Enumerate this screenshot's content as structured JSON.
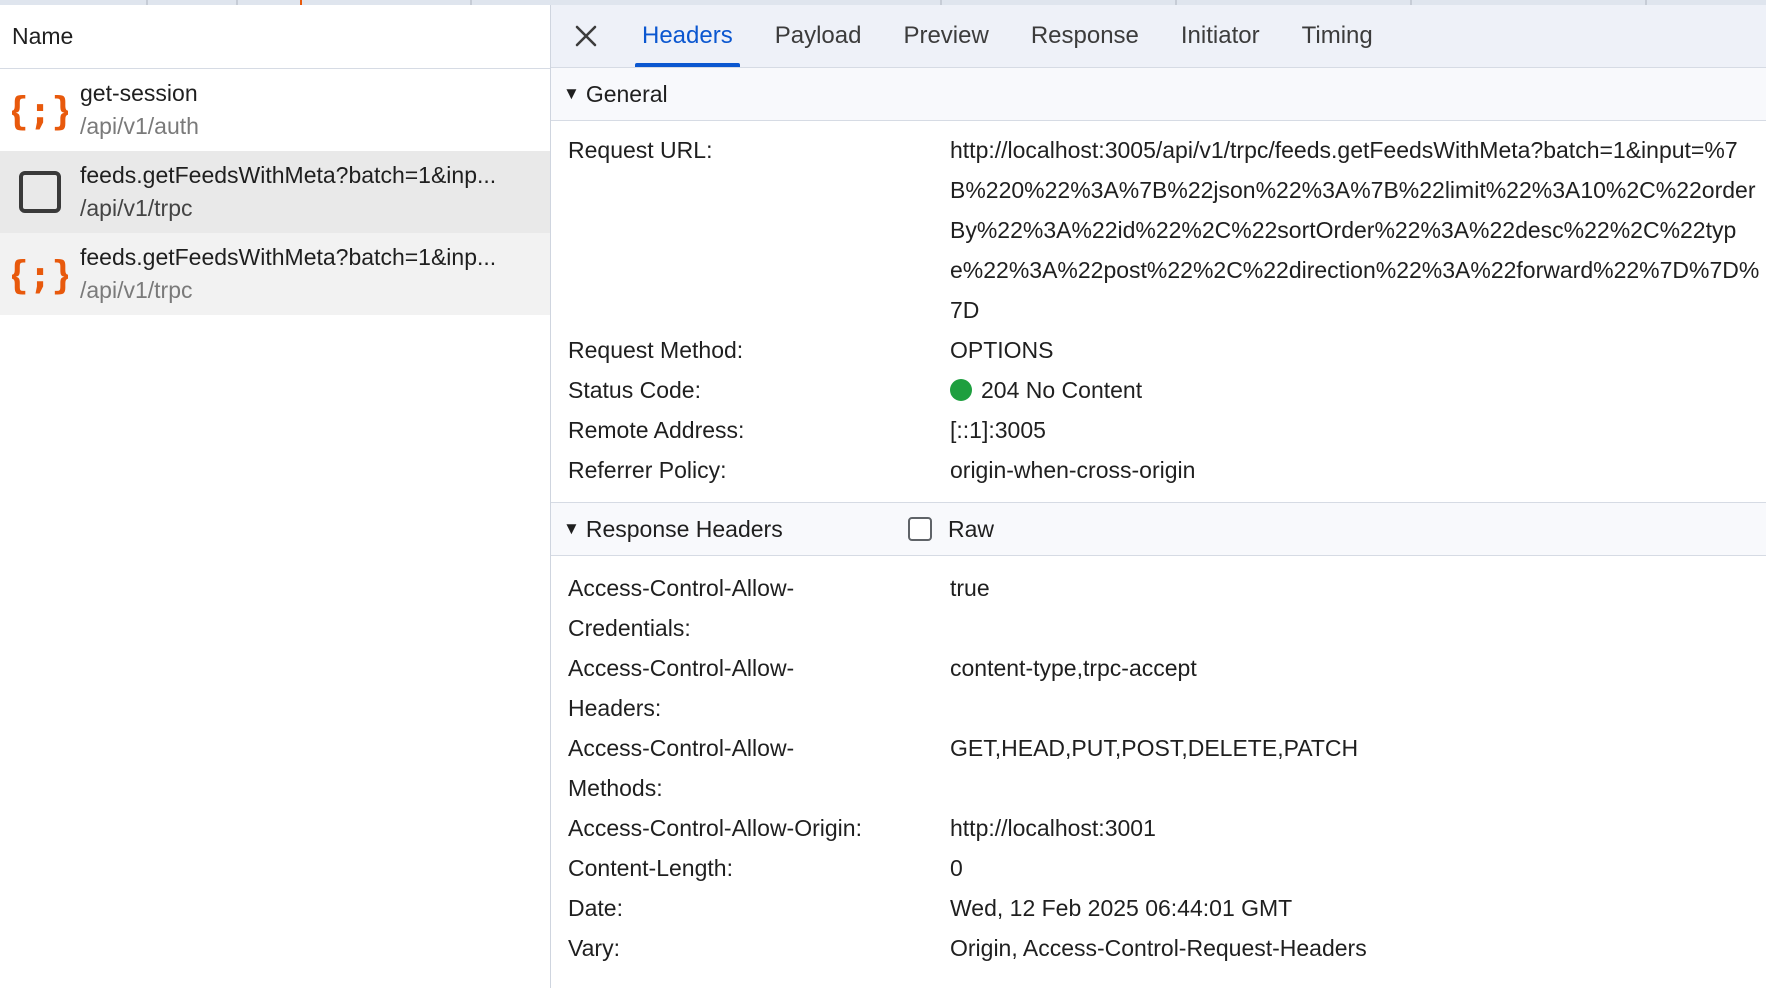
{
  "list": {
    "header": "Name",
    "requests": [
      {
        "name": "get-session",
        "path": "/api/v1/auth",
        "icon": "fetch-braces-icon"
      },
      {
        "name": "feeds.getFeedsWithMeta?batch=1&inp...",
        "path": "/api/v1/trpc",
        "icon": "preflight-square-icon"
      },
      {
        "name": "feeds.getFeedsWithMeta?batch=1&inp...",
        "path": "/api/v1/trpc",
        "icon": "fetch-braces-icon"
      }
    ]
  },
  "tabs": [
    "Headers",
    "Payload",
    "Preview",
    "Response",
    "Initiator",
    "Timing"
  ],
  "active_tab": "Headers",
  "general": {
    "title": "General",
    "rows": {
      "request_url": {
        "key": "Request URL:",
        "value": "http://localhost:3005/api/v1/trpc/feeds.getFeedsWithMeta?batch=1&input=%7B%220%22%3A%7B%22json%22%3A%7B%22limit%22%3A10%2C%22orderBy%22%3A%22id%22%2C%22sortOrder%22%3A%22desc%22%2C%22type%22%3A%22post%22%2C%22direction%22%3A%22forward%22%7D%7D%7D"
      },
      "request_method": {
        "key": "Request Method:",
        "value": "OPTIONS"
      },
      "status_code": {
        "key": "Status Code:",
        "value": "204 No Content",
        "status_color": "#1e9f3f"
      },
      "remote_address": {
        "key": "Remote Address:",
        "value": "[::1]:3005"
      },
      "referrer_policy": {
        "key": "Referrer Policy:",
        "value": "origin-when-cross-origin"
      }
    }
  },
  "response_headers": {
    "title": "Response Headers",
    "raw_label": "Raw",
    "raw_checked": false,
    "rows": [
      {
        "key": "Access-Control-Allow-Credentials:",
        "value": "true"
      },
      {
        "key": "Access-Control-Allow-Headers:",
        "value": "content-type,trpc-accept"
      },
      {
        "key": "Access-Control-Allow-Methods:",
        "value": "GET,HEAD,PUT,POST,DELETE,PATCH"
      },
      {
        "key": "Access-Control-Allow-Origin:",
        "value": "http://localhost:3001"
      },
      {
        "key": "Content-Length:",
        "value": "0"
      },
      {
        "key": "Date:",
        "value": "Wed, 12 Feb 2025 06:44:01 GMT"
      },
      {
        "key": "Vary:",
        "value": "Origin, Access-Control-Request-Headers"
      }
    ]
  },
  "colors": {
    "accent": "#0b57d0",
    "fetch_icon": "#e8590c",
    "status_ok": "#1e9f3f"
  }
}
